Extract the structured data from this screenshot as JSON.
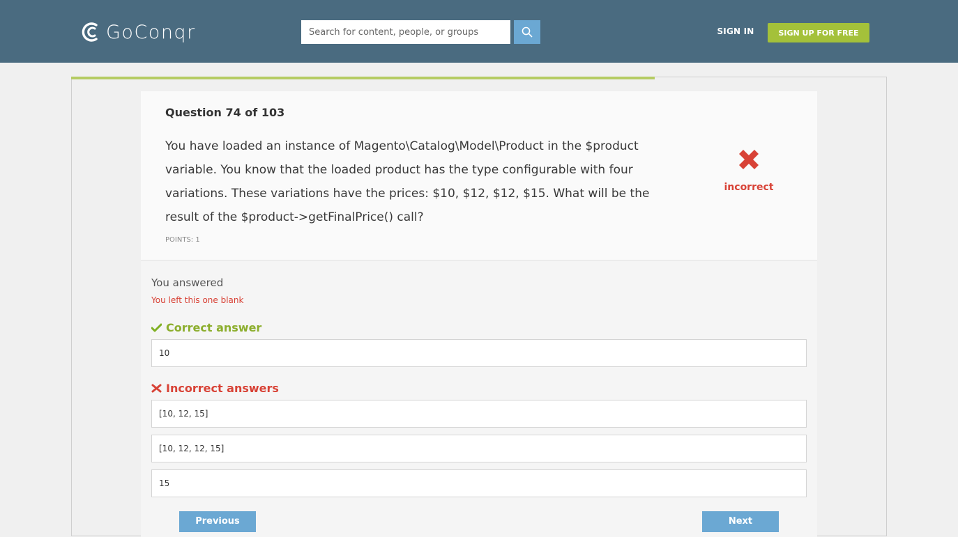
{
  "header": {
    "logo_text": "GoConqr",
    "search_placeholder": "Search for content, people, or groups",
    "signin_label": "SIGN IN",
    "signup_label": "SIGN UP FOR FREE"
  },
  "quiz": {
    "progress_fraction": 0.715,
    "question_number": "Question 74 of 103",
    "question_text": "You have loaded an instance of Magento\\Catalog\\Model\\Product in the $product variable. You know that the loaded product has the type configurable with four variations. These variations have the prices: $10, $12, $12, $15. What will be the result of the $product->getFinalPrice() call?",
    "points": "POINTS: 1",
    "verdict": "incorrect",
    "you_answered_label": "You answered",
    "you_answered_value": "You left this one blank",
    "correct_label": "Correct answer",
    "correct_answer": "10",
    "incorrect_label": "Incorrect answers",
    "incorrect_answers": [
      "[10, 12, 15]",
      "[10, 12, 12, 15]",
      "15"
    ],
    "previous_label": "Previous",
    "next_label": "Next"
  },
  "colors": {
    "header_bg": "#4a6b80",
    "accent_green": "#a4c13a",
    "accent_blue": "#6ba8d3",
    "error_red": "#d84236",
    "correct_green": "#8cae2d"
  },
  "icons": {
    "logo": "goconqr-logo-icon",
    "search": "search-icon",
    "verdict": "cross-icon",
    "correct": "check-icon",
    "incorrect": "cross-small-icon"
  }
}
